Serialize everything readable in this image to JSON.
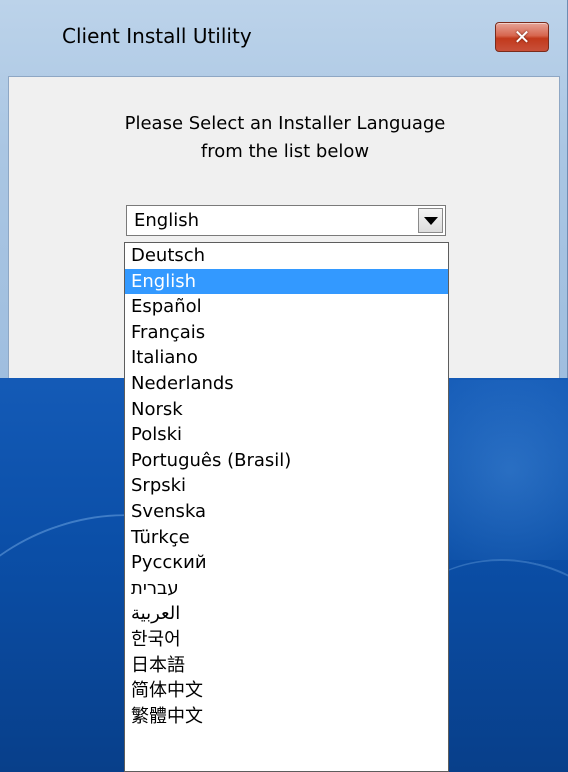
{
  "window": {
    "title": "Client Install Utility",
    "close_symbol": "✕"
  },
  "prompt": {
    "line1": "Please Select an Installer Language",
    "line2": "from the list below"
  },
  "language_select": {
    "selected": "English",
    "options": [
      "Deutsch",
      "English",
      "Español",
      "Français",
      "Italiano",
      "Nederlands",
      "Norsk",
      "Polski",
      "Português (Brasil)",
      "Srpski",
      "Svenska",
      "Türkçe",
      "Русский",
      "עברית",
      "العربية",
      "한국어",
      "日本語",
      "简体中文",
      "繁體中文"
    ],
    "highlighted_index": 1
  },
  "colors": {
    "highlight": "#3399ff",
    "close_button": "#c2391c",
    "title_bar": "#aac6e3"
  }
}
